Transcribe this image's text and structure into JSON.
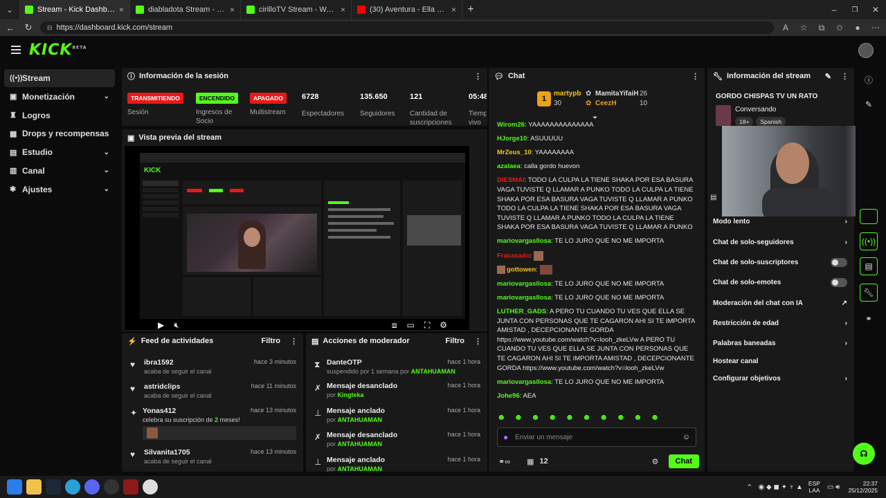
{
  "browser": {
    "tabs": [
      {
        "title": "Stream - Kick Dashboard",
        "active": true
      },
      {
        "title": "diabladota Stream - Watch Live on Kick"
      },
      {
        "title": "cirilloTV Stream - Watch Live on Kick"
      },
      {
        "title": "(30) Aventura - Ella y Yo (ft. Don Omar)"
      }
    ],
    "url": "https://dashboard.kick.com/stream"
  },
  "app": {
    "logo": "KICK",
    "logo_tag": "BETA"
  },
  "sidebar": {
    "items": [
      {
        "label": "Stream",
        "icon": "broadcast-icon",
        "active": true
      },
      {
        "label": "Monetización",
        "icon": "money-icon",
        "chevron": true
      },
      {
        "label": "Logros",
        "icon": "trophy-icon"
      },
      {
        "label": "Drops y recompensas",
        "icon": "gift-icon"
      },
      {
        "label": "Estudio",
        "icon": "studio-icon",
        "chevron": true
      },
      {
        "label": "Canal",
        "icon": "channel-icon",
        "chevron": true
      },
      {
        "label": "Ajustes",
        "icon": "settings-icon",
        "chevron": true
      }
    ]
  },
  "session": {
    "title": "Información de la sesión",
    "badges": [
      {
        "badge": "TRANSMITIENDO",
        "label": "Sesión"
      },
      {
        "badge": "ENCENDIDO",
        "label": "Ingresos de Socio"
      },
      {
        "badge": "APAGADO",
        "label": "Multistream"
      }
    ],
    "stats": [
      {
        "value": "6728",
        "label": "Espectadores"
      },
      {
        "value": "135.650",
        "label": "Seguidores"
      },
      {
        "value": "121",
        "label": "Cantidad de suscripciones"
      },
      {
        "value": "05:48",
        "label": "Tiempo en vivo"
      }
    ]
  },
  "preview": {
    "title": "Vista previa del stream"
  },
  "activity": {
    "title": "Feed de actividades",
    "filter": "Filtro",
    "items": [
      {
        "user": "ibra1592",
        "desc": "acaba de seguir el canal",
        "time": "hace 3 minutos",
        "icon": "heart-icon"
      },
      {
        "user": "astridclips",
        "desc": "acaba de seguir el canal",
        "time": "hace 11 minutos",
        "icon": "heart-icon"
      },
      {
        "user": "Yonas412",
        "desc_pre": "celebra su suscripción de",
        "desc_num": "2",
        "desc_post": "meses!",
        "time": "hace 13 minutos",
        "icon": "star-icon"
      },
      {
        "user": "Silvanita1705",
        "desc": "acaba de seguir el canal",
        "time": "hace 13 minutos",
        "icon": "heart-icon"
      }
    ]
  },
  "moderator": {
    "title": "Acciones de moderador",
    "filter": "Filtro",
    "items": [
      {
        "action": "DanteOTP",
        "pre": "suspendido por 1 semana por",
        "by": "ANTAHUAMAN",
        "time": "hace 1 hora",
        "icon": "hourglass-icon"
      },
      {
        "action": "Mensaje desanclado",
        "pre": "por",
        "by": "Kingteka",
        "time": "hace 1 hora",
        "icon": "unpin-icon"
      },
      {
        "action": "Mensaje anclado",
        "pre": "por",
        "by": "ANTAHUAMAN",
        "time": "hace 1 hora",
        "icon": "pin-icon"
      },
      {
        "action": "Mensaje desanclado",
        "pre": "por",
        "by": "ANTAHUAMAN",
        "time": "hace 1 hora",
        "icon": "unpin-icon"
      },
      {
        "action": "Mensaje anclado",
        "pre": "por",
        "by": "ANTAHUAMAN",
        "time": "hace 1 hora",
        "icon": "pin-icon"
      }
    ]
  },
  "chat": {
    "title": "Chat",
    "leaderboard": {
      "first_rank": "1",
      "first_user": "martypb",
      "first_count": "30",
      "second_user": "MamitaYifaiH",
      "second_count": "26",
      "third_user": "CeezH",
      "third_count": "10"
    },
    "messages": [
      {
        "user": "Wirom26",
        "color": "#53fc18",
        "text": "YAAAAAAAAAAAAAA"
      },
      {
        "user": "HJorge10",
        "color": "#53fc18",
        "text": "ASUUUUU"
      },
      {
        "user": "MrZeus_10",
        "color": "#f5c518",
        "text": "YAAAAAAAA"
      },
      {
        "user": "azalaea",
        "color": "#53fc18",
        "text": "calla gordo huevon"
      },
      {
        "user": "DIESMAI",
        "color": "#e91916",
        "text": "TODO LA CULPA LA TIENE SHAKA POR ESA BASURA VAGA TUVISTE Q LLAMAR A PUNKO TODO LA CULPA LA TIENE SHAKA POR ESA BASURA VAGA TUVISTE Q LLAMAR A PUNKO TODO LA CULPA LA TIENE SHAKA POR ESA BASURA VAGA TUVISTE Q LLAMAR A PUNKO TODO LA CULPA LA TIENE SHAKA POR ESA BASURA VAGA TUVISTE Q LLAMAR A PUNKO"
      },
      {
        "user": "mariovargasllosa",
        "color": "#53fc18",
        "text": "TE LO JURO QUE NO ME IMPORTA"
      },
      {
        "user": "Fracasado",
        "color": "#e91916",
        "text": ""
      },
      {
        "user": "gottowen",
        "color": "#f5c518",
        "text": ""
      },
      {
        "user": "mariovargasllosa",
        "color": "#53fc18",
        "text": "TE LO JURO QUE NO ME IMPORTA"
      },
      {
        "user": "mariovargasllosa",
        "color": "#53fc18",
        "text": "TE LO JURO QUE NO ME IMPORTA"
      },
      {
        "user": "LUTHER_GADS",
        "color": "#53fc18",
        "text": "A PERO TU CUANDO TU VES QUE ELLA SE JUNTA CON PERSONAS QUE TE CAGARON AHI SI TE IMPORTA AMISTAD , DECEPCIONANTE GORDA https://www.youtube.com/watch?v=looh_zkeLVw A PERO TU CUANDO TU VES QUE ELLA SE JUNTA CON PERSONAS QUE TE CAGARON AHI SI TE IMPORTA AMISTAD , DECEPCIONANTE GORDA https://www.youtube.com/watch?v=looh_zkeLVw"
      },
      {
        "user": "mariovargasllosa",
        "color": "#53fc18",
        "text": "TE LO JURO QUE NO ME IMPORTA"
      },
      {
        "user": "Johe96",
        "color": "#53fc18",
        "text": "AEA"
      }
    ],
    "input_placeholder": "Enviar un mensaje",
    "points": "12",
    "send_label": "Chat"
  },
  "stream_info": {
    "title": "Información del stream",
    "stream_title": "GORDO CHISPAS TV UN RATO",
    "category": "Conversando",
    "tags": [
      "18+",
      "Spanish"
    ],
    "settings": [
      {
        "label": "Modo lento",
        "type": "chevron"
      },
      {
        "label": "Chat de solo-seguidores",
        "type": "chevron"
      },
      {
        "label": "Chat de solo-suscriptores",
        "type": "toggle"
      },
      {
        "label": "Chat de solo-emotes",
        "type": "toggle"
      },
      {
        "label": "Moderación del chat con IA",
        "type": "external"
      },
      {
        "label": "Restricción de edad",
        "type": "chevron"
      },
      {
        "label": "Palabras baneadas",
        "type": "chevron"
      },
      {
        "label": "Hostear canal",
        "type": "none"
      },
      {
        "label": "Configurar objetivos",
        "type": "chevron"
      }
    ]
  },
  "taskbar": {
    "lang": "ESP",
    "lang2": "LAA",
    "time": "22:37",
    "date": "25/12/2025"
  },
  "colors": {
    "accent": "#53fc18",
    "live_red": "#e91916",
    "panel": "#191919",
    "bg": "#0b0b0b"
  }
}
